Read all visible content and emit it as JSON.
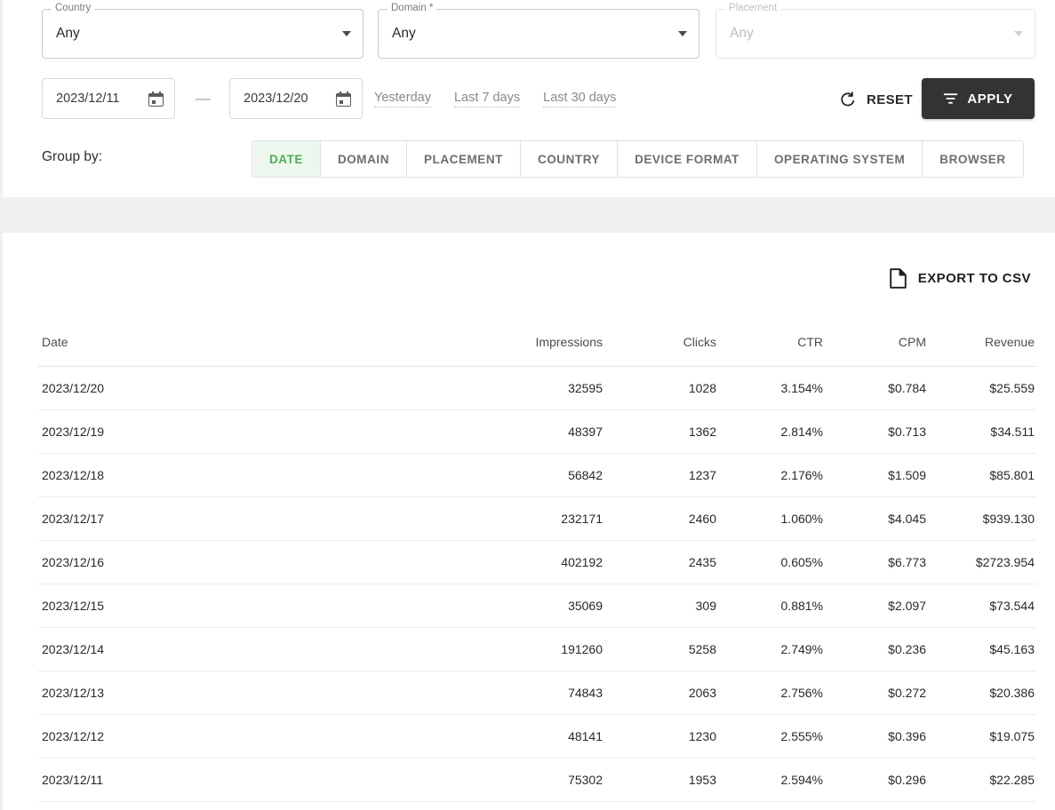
{
  "filters": {
    "country": {
      "label": "Country",
      "value": "Any",
      "icon": "chevron-down-icon"
    },
    "domain": {
      "label": "Domain *",
      "value": "Any",
      "icon": "chevron-down-icon"
    },
    "placement": {
      "label": "Placement",
      "value": "Any",
      "icon": "chevron-down-icon"
    }
  },
  "date_range": {
    "from": "2023/12/11",
    "to": "2023/12/20",
    "separator": "—",
    "calendar_icon": "calendar-icon",
    "quick_ranges": [
      "Yesterday",
      "Last 7 days",
      "Last 30 days"
    ]
  },
  "actions": {
    "reset_label": "RESET",
    "reset_icon": "refresh-icon",
    "apply_label": "APPLY",
    "apply_icon": "filter-icon",
    "apply_bg": "#333333",
    "export_label": "EXPORT TO CSV",
    "export_icon": "file-icon"
  },
  "group_by": {
    "label": "Group by:",
    "active": "DATE",
    "active_color": "#4caf50",
    "active_bg": "#eef7ee",
    "tabs": [
      "DATE",
      "DOMAIN",
      "PLACEMENT",
      "COUNTRY",
      "DEVICE FORMAT",
      "OPERATING SYSTEM",
      "BROWSER"
    ]
  },
  "table": {
    "columns": [
      "Date",
      "Impressions",
      "Clicks",
      "CTR",
      "CPM",
      "Revenue"
    ],
    "rows": [
      {
        "date": "2023/12/20",
        "impressions": "32595",
        "clicks": "1028",
        "ctr": "3.154%",
        "cpm": "$0.784",
        "revenue": "$25.559"
      },
      {
        "date": "2023/12/19",
        "impressions": "48397",
        "clicks": "1362",
        "ctr": "2.814%",
        "cpm": "$0.713",
        "revenue": "$34.511"
      },
      {
        "date": "2023/12/18",
        "impressions": "56842",
        "clicks": "1237",
        "ctr": "2.176%",
        "cpm": "$1.509",
        "revenue": "$85.801"
      },
      {
        "date": "2023/12/17",
        "impressions": "232171",
        "clicks": "2460",
        "ctr": "1.060%",
        "cpm": "$4.045",
        "revenue": "$939.130"
      },
      {
        "date": "2023/12/16",
        "impressions": "402192",
        "clicks": "2435",
        "ctr": "0.605%",
        "cpm": "$6.773",
        "revenue": "$2723.954"
      },
      {
        "date": "2023/12/15",
        "impressions": "35069",
        "clicks": "309",
        "ctr": "0.881%",
        "cpm": "$2.097",
        "revenue": "$73.544"
      },
      {
        "date": "2023/12/14",
        "impressions": "191260",
        "clicks": "5258",
        "ctr": "2.749%",
        "cpm": "$0.236",
        "revenue": "$45.163"
      },
      {
        "date": "2023/12/13",
        "impressions": "74843",
        "clicks": "2063",
        "ctr": "2.756%",
        "cpm": "$0.272",
        "revenue": "$20.386"
      },
      {
        "date": "2023/12/12",
        "impressions": "48141",
        "clicks": "1230",
        "ctr": "2.555%",
        "cpm": "$0.396",
        "revenue": "$19.075"
      },
      {
        "date": "2023/12/11",
        "impressions": "75302",
        "clicks": "1953",
        "ctr": "2.594%",
        "cpm": "$0.296",
        "revenue": "$22.285"
      }
    ]
  }
}
